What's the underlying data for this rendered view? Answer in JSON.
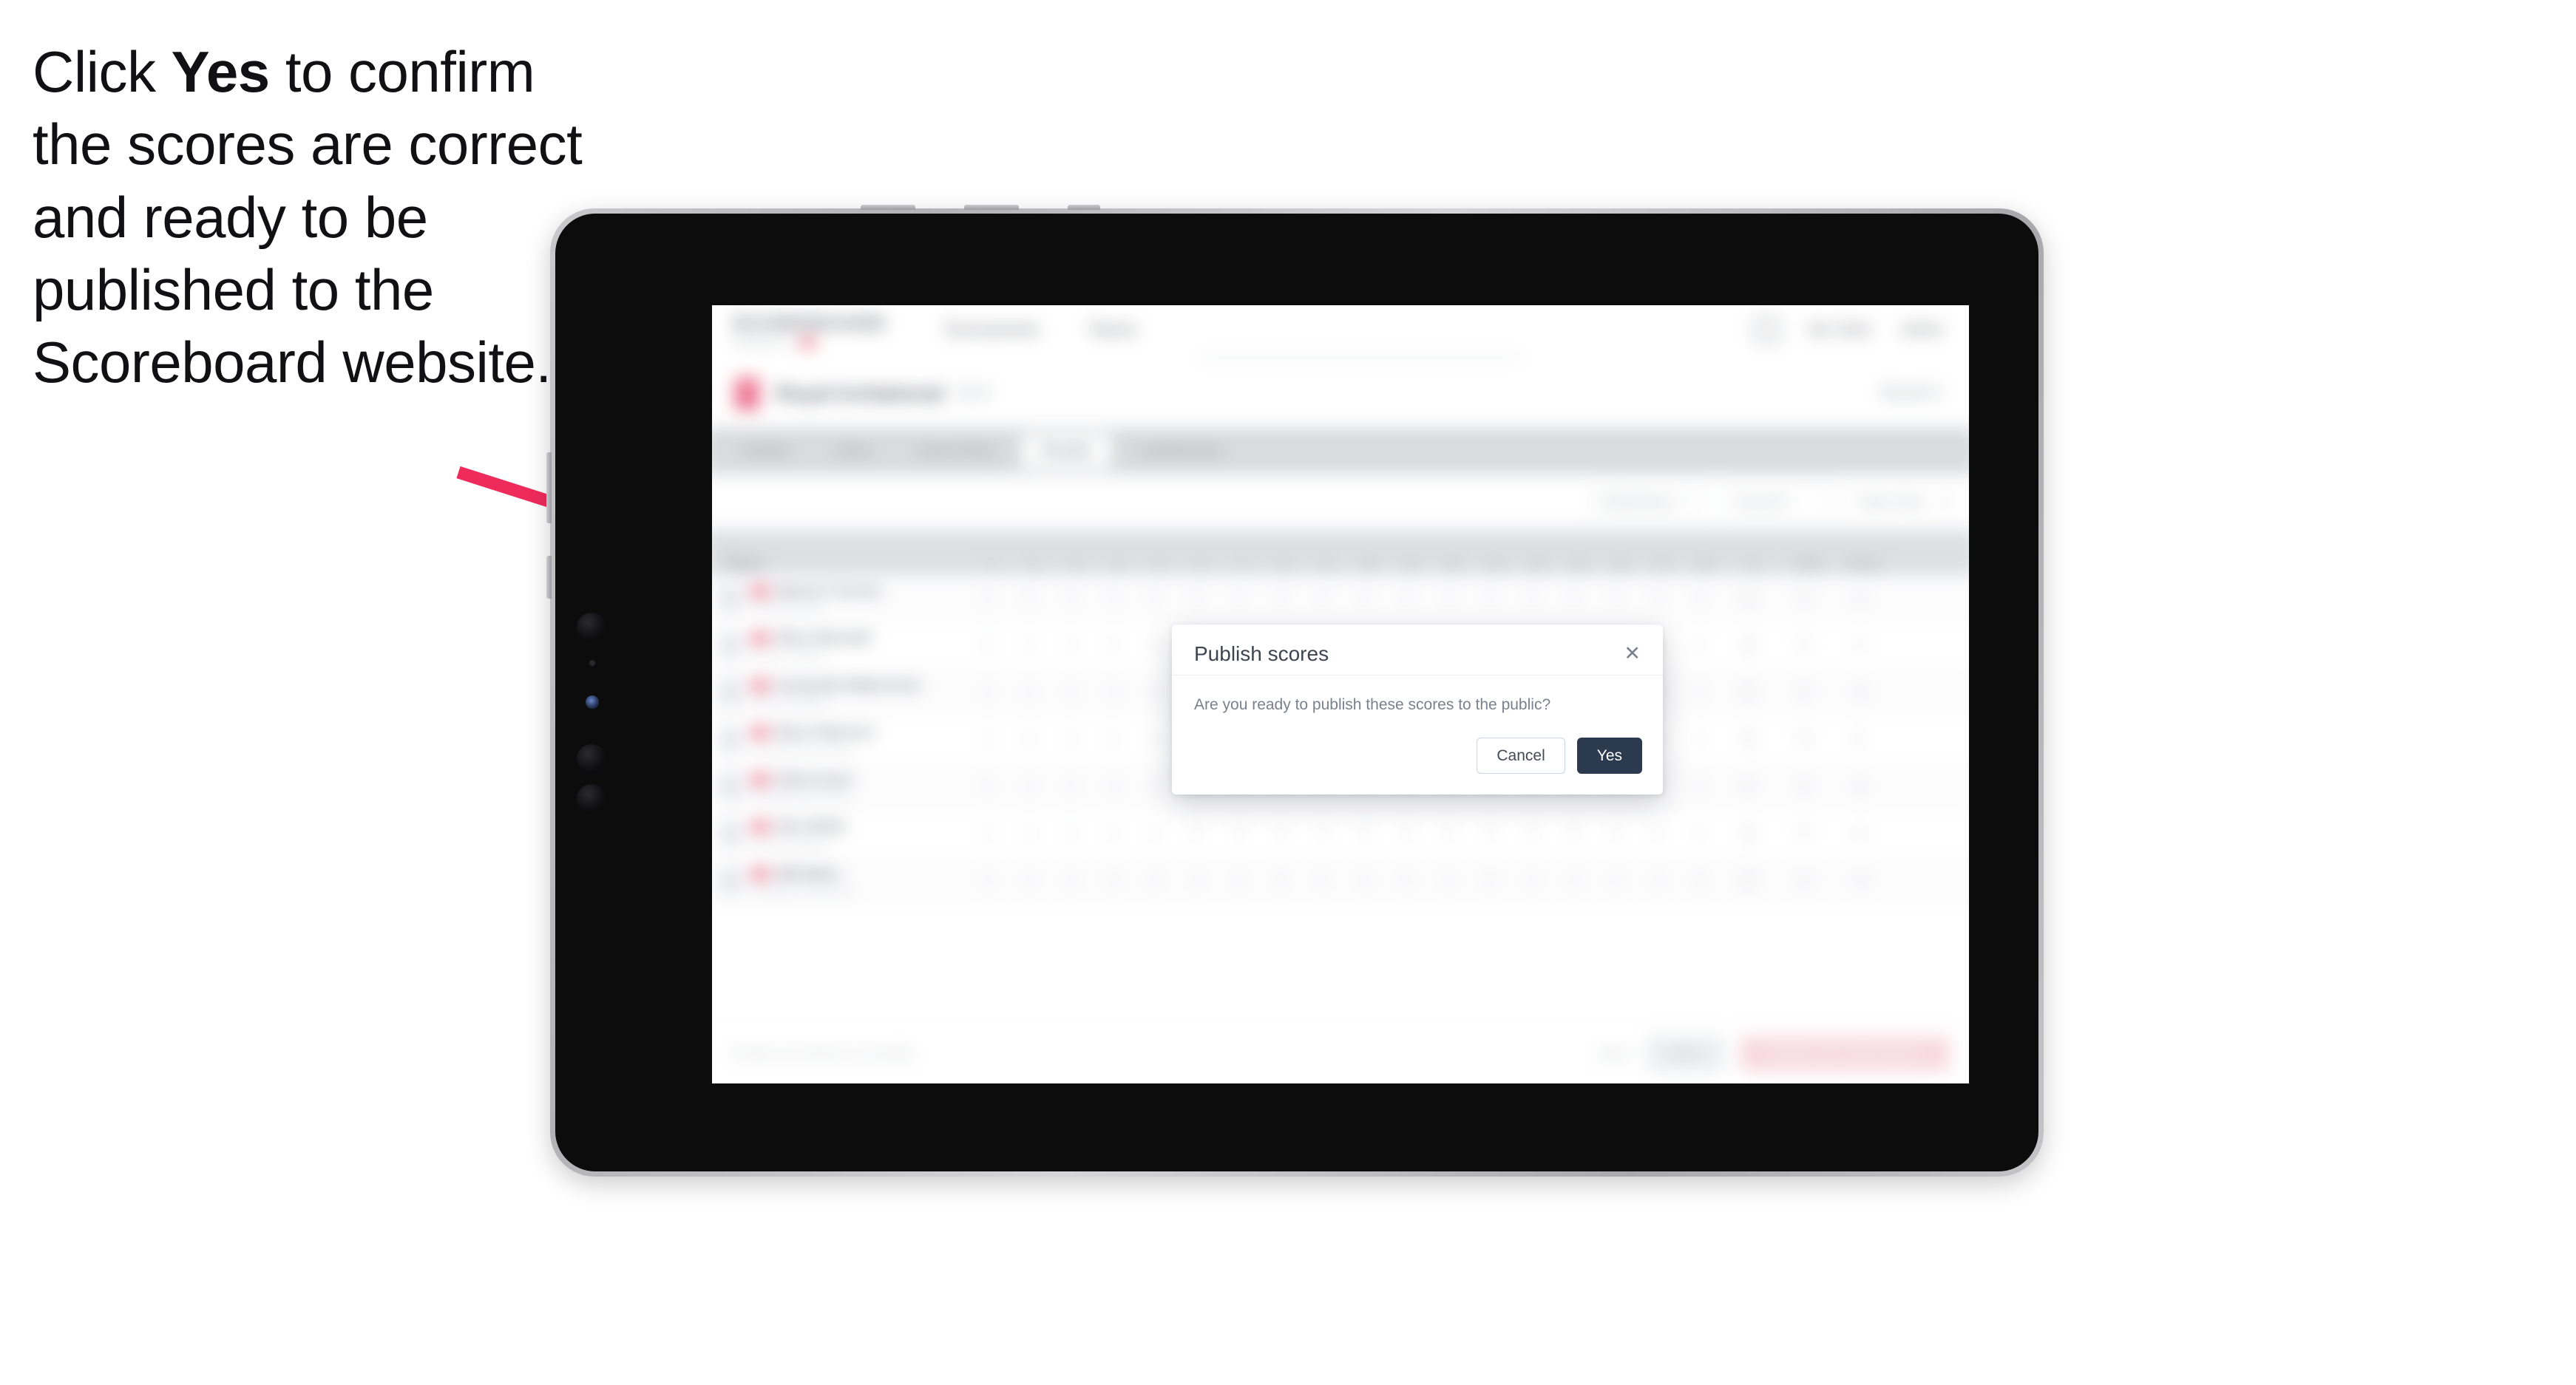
{
  "callout": {
    "line_start": "Click ",
    "emphasis": "Yes",
    "line_rest": " to confirm the scores are correct and ready to be published to the Scoreboard website."
  },
  "colors": {
    "arrow": "#ef2b5c",
    "accent_pink": "#f4486f",
    "modal_primary": "#2c3a50",
    "tablet_bezel": "#c2c2c5",
    "tablet_body": "#0c0c0c"
  },
  "app": {
    "nav": {
      "brand_word": "SCOREBOARD",
      "brand_sub": "POWERED BY",
      "links": [
        "Tournaments",
        "Teams"
      ],
      "right": {
        "icon": "grid-icon",
        "links": [
          "My Clubs",
          "Admin"
        ]
      }
    },
    "subheader": {
      "competition": "Royal Invitational",
      "competition_sub": "2024",
      "right_meta": "Round 3"
    },
    "tabs": [
      {
        "label": "Details",
        "active": false
      },
      {
        "label": "Draw",
        "active": false
      },
      {
        "label": "Score Entry",
        "active": false
      },
      {
        "label": "Results",
        "active": true
      },
      {
        "label": "Leaderboard",
        "active": false
      }
    ],
    "filters": {
      "select_division": "All Divisions",
      "select_round": "Round 3",
      "toggle_label": "Team Only",
      "toggle_clear": "✕"
    },
    "table": {
      "columns_player": "Player",
      "holes": [
        "1",
        "2",
        "3",
        "4",
        "5",
        "6",
        "7",
        "8",
        "9",
        "10",
        "11",
        "12",
        "13",
        "14",
        "15",
        "16",
        "17",
        "18"
      ],
      "wide_columns": [
        "In",
        "Total",
        "Points"
      ],
      "rows": [
        {
          "name": "Spencer Torrens",
          "team": "Eastern Cobras",
          "holes": [
            "4",
            "5",
            "4",
            "3",
            "4",
            "5",
            "4",
            "3",
            "4",
            "4",
            "5",
            "3",
            "4",
            "4",
            "5",
            "4",
            "3",
            "4"
          ],
          "wide": [
            "36",
            "72",
            "+2"
          ]
        },
        {
          "name": "Ellery Marshall",
          "team": "Eastern Cobras",
          "holes": [
            "5",
            "4",
            "4",
            "4",
            "3",
            "5",
            "4",
            "4",
            "3",
            "5",
            "4",
            "4",
            "3",
            "5",
            "4",
            "4",
            "4",
            "3"
          ],
          "wide": [
            "36",
            "71",
            "+1"
          ]
        },
        {
          "name": "Cassandra Waterstone",
          "team": "Northern Eagles",
          "holes": [
            "4",
            "4",
            "5",
            "3",
            "4",
            "4",
            "5",
            "4",
            "4",
            "4",
            "4",
            "5",
            "3",
            "4",
            "4",
            "4",
            "5",
            "4"
          ],
          "wide": [
            "36",
            "73",
            "+3"
          ]
        },
        {
          "name": "Rhys Patterson",
          "team": "Southland Hurricanes",
          "holes": [
            "4",
            "5",
            "3",
            "4",
            "4",
            "4",
            "5",
            "4",
            "3",
            "4",
            "5",
            "4",
            "4",
            "3",
            "5",
            "4",
            "4",
            "4"
          ],
          "wide": [
            "35",
            "70",
            "E"
          ]
        },
        {
          "name": "Olivia Grant",
          "team": "Southland Hurricanes",
          "holes": [
            "5",
            "4",
            "4",
            "3",
            "5",
            "4",
            "4",
            "4",
            "4",
            "4",
            "3",
            "5",
            "4",
            "4",
            "4",
            "5",
            "3",
            "4"
          ],
          "wide": [
            "37",
            "74",
            "+4"
          ]
        },
        {
          "name": "Nina Webb",
          "team": "Northern Eagles",
          "holes": [
            "4",
            "3",
            "5",
            "4",
            "4",
            "5",
            "3",
            "4",
            "4",
            "5",
            "4",
            "4",
            "4",
            "3",
            "5",
            "4",
            "4",
            "4"
          ],
          "wide": [
            "36",
            "72",
            "+2"
          ]
        },
        {
          "name": "Will Baker",
          "team": "Southland Hurricanes",
          "holes": [
            "4",
            "4",
            "4",
            "5",
            "3",
            "4",
            "4",
            "5",
            "4",
            "4",
            "4",
            "3",
            "5",
            "4",
            "4",
            "4",
            "4",
            "5"
          ],
          "wide": [
            "36",
            "73",
            "+3"
          ]
        }
      ]
    },
    "bottom": {
      "note": "Results not entered successfully",
      "link": "Reset",
      "secondary_button": "Save",
      "primary_button": "Publish and notify players"
    }
  },
  "modal": {
    "title": "Publish scores",
    "close_icon": "✕",
    "body": "Are you ready to publish these scores to the public?",
    "cancel_label": "Cancel",
    "confirm_label": "Yes"
  }
}
